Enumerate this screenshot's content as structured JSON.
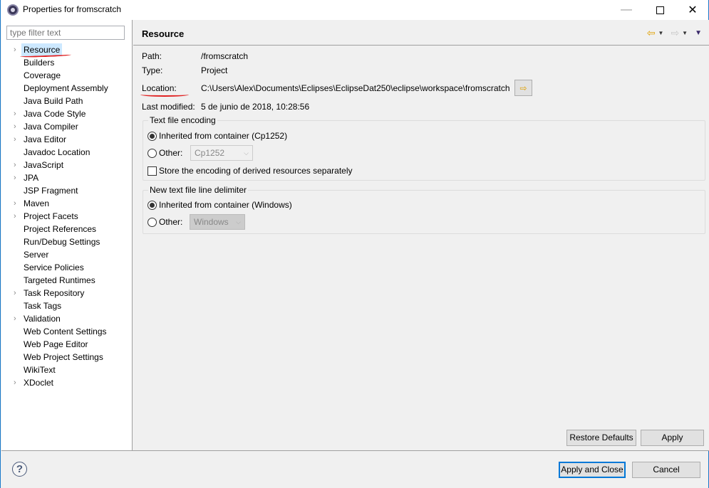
{
  "window": {
    "title": "Properties for fromscratch",
    "controls": {
      "minimize": "—",
      "close": "✕"
    }
  },
  "sidebar": {
    "filter_placeholder": "type filter text",
    "items": [
      {
        "label": "Resource",
        "expandable": true,
        "selected": true
      },
      {
        "label": "Builders",
        "expandable": false
      },
      {
        "label": "Coverage",
        "expandable": false
      },
      {
        "label": "Deployment Assembly",
        "expandable": false
      },
      {
        "label": "Java Build Path",
        "expandable": false
      },
      {
        "label": "Java Code Style",
        "expandable": true
      },
      {
        "label": "Java Compiler",
        "expandable": true
      },
      {
        "label": "Java Editor",
        "expandable": true
      },
      {
        "label": "Javadoc Location",
        "expandable": false
      },
      {
        "label": "JavaScript",
        "expandable": true
      },
      {
        "label": "JPA",
        "expandable": true
      },
      {
        "label": "JSP Fragment",
        "expandable": false
      },
      {
        "label": "Maven",
        "expandable": true
      },
      {
        "label": "Project Facets",
        "expandable": true
      },
      {
        "label": "Project References",
        "expandable": false
      },
      {
        "label": "Run/Debug Settings",
        "expandable": false
      },
      {
        "label": "Server",
        "expandable": false
      },
      {
        "label": "Service Policies",
        "expandable": false
      },
      {
        "label": "Targeted Runtimes",
        "expandable": false
      },
      {
        "label": "Task Repository",
        "expandable": true
      },
      {
        "label": "Task Tags",
        "expandable": false
      },
      {
        "label": "Validation",
        "expandable": true
      },
      {
        "label": "Web Content Settings",
        "expandable": false
      },
      {
        "label": "Web Page Editor",
        "expandable": false
      },
      {
        "label": "Web Project Settings",
        "expandable": false
      },
      {
        "label": "WikiText",
        "expandable": false
      },
      {
        "label": "XDoclet",
        "expandable": true
      }
    ]
  },
  "page": {
    "title": "Resource",
    "properties": {
      "path_label": "Path:",
      "path_value": "/fromscratch",
      "type_label": "Type:",
      "type_value": "Project",
      "location_label": "Location:",
      "location_value": "C:\\Users\\Alex\\Documents\\Eclipses\\EclipseDat250\\eclipse\\workspace\\fromscratch",
      "modified_label": "Last modified:",
      "modified_value": "5 de junio de 2018, 10:28:56"
    },
    "encoding": {
      "group_title": "Text file encoding",
      "inherited_label": "Inherited from container (Cp1252)",
      "inherited_selected": true,
      "other_label": "Other:",
      "other_value": "Cp1252",
      "store_derived_label": "Store the encoding of derived resources separately",
      "store_derived_checked": false
    },
    "delimiter": {
      "group_title": "New text file line delimiter",
      "inherited_label": "Inherited from container (Windows)",
      "inherited_selected": true,
      "other_label": "Other:",
      "other_value": "Windows"
    },
    "buttons": {
      "restore_defaults": "Restore Defaults",
      "apply": "Apply"
    }
  },
  "footer": {
    "apply_close": "Apply and Close",
    "cancel": "Cancel",
    "help_glyph": "?"
  },
  "icons": {
    "back": "⇦",
    "forward": "⇨",
    "dropdown": "▼",
    "chevron": "›",
    "combo_arrow": "⌵",
    "browse": "⇨"
  }
}
